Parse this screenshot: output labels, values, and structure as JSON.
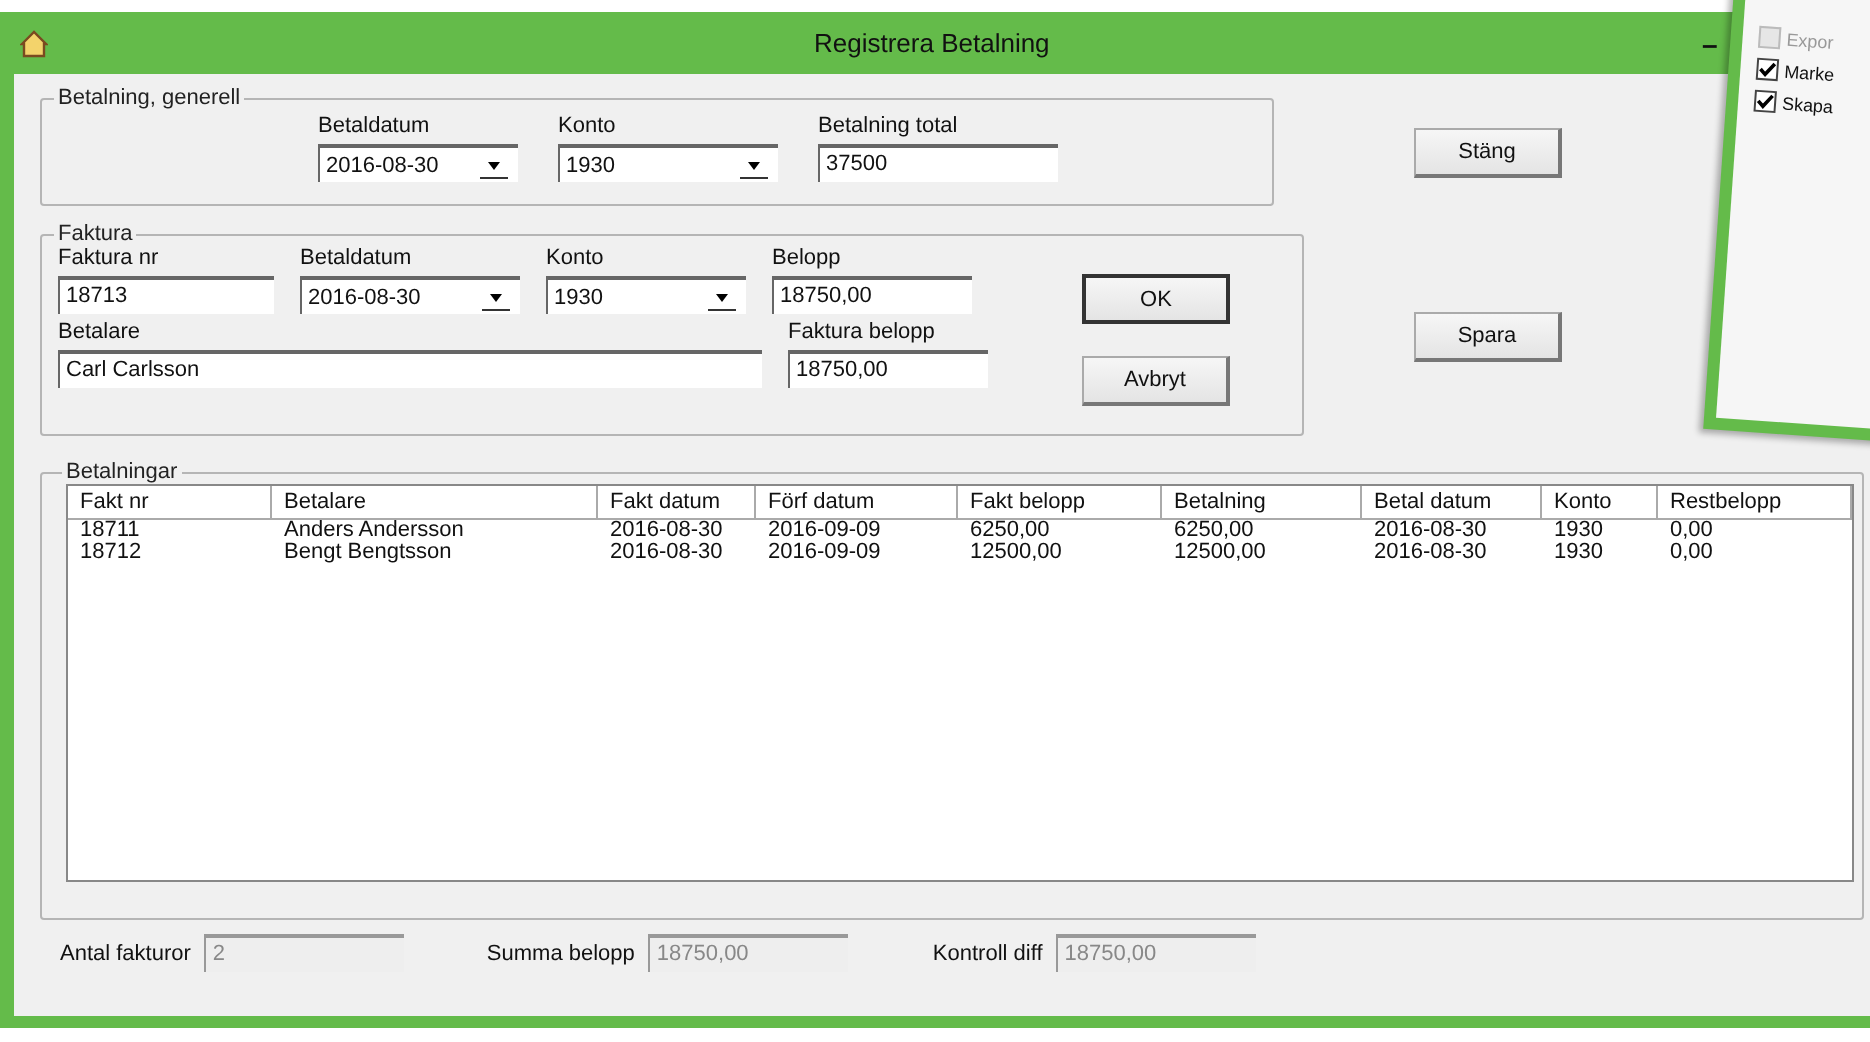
{
  "window": {
    "title": "Registrera Betalning",
    "minimize": "–"
  },
  "general": {
    "title": "Betalning, generell",
    "fields": [
      {
        "label": "Betaldatum",
        "value": "2016-08-30",
        "kind": "combo"
      },
      {
        "label": "Konto",
        "value": "1930",
        "kind": "combo"
      },
      {
        "label": "Betalning total",
        "value": "37500",
        "kind": "text"
      }
    ]
  },
  "faktura": {
    "title": "Faktura",
    "fields": [
      {
        "label": "Faktura nr",
        "value": "18713",
        "kind": "text"
      },
      {
        "label": "Betaldatum",
        "value": "2016-08-30",
        "kind": "combo"
      },
      {
        "label": "Konto",
        "value": "1930",
        "kind": "combo"
      },
      {
        "label": "Belopp",
        "value": "18750,00",
        "kind": "text"
      }
    ],
    "payer": {
      "label": "Betalare",
      "value": "Carl Carlsson"
    },
    "invoice_amount": {
      "label": "Faktura belopp",
      "value": "18750,00"
    }
  },
  "buttons": [
    {
      "label": "Stäng",
      "default": false
    },
    {
      "label": "OK",
      "default": true
    },
    {
      "label": "Avbryt",
      "default": false
    },
    {
      "label": "Spara",
      "default": false
    }
  ],
  "payments": {
    "title": "Betalningar",
    "columns": [
      "Fakt nr",
      "Betalare",
      "Fakt datum",
      "Förf datum",
      "Fakt belopp",
      "Betalning",
      "Betal datum",
      "Konto",
      "Restbelopp"
    ],
    "rows": [
      [
        "18711",
        "Anders Andersson",
        "2016-08-30",
        "2016-09-09",
        "6250,00",
        "6250,00",
        "2016-08-30",
        "1930",
        "0,00"
      ],
      [
        "18712",
        "Bengt Bengtsson",
        "2016-08-30",
        "2016-09-09",
        "12500,00",
        "12500,00",
        "2016-08-30",
        "1930",
        "0,00"
      ]
    ]
  },
  "footer": [
    {
      "label": "Antal fakturor",
      "value": "2",
      "disabled": true
    },
    {
      "label": "Summa belopp",
      "value": "18750,00",
      "disabled": true
    },
    {
      "label": "Kontroll diff",
      "value": "18750,00",
      "disabled": true
    }
  ],
  "overlay_window": {
    "options": [
      {
        "label": "Expor",
        "checked": false,
        "disabled": true
      },
      {
        "label": "Marke",
        "checked": true,
        "disabled": false
      },
      {
        "label": "Skapa",
        "checked": true,
        "disabled": false
      }
    ]
  }
}
